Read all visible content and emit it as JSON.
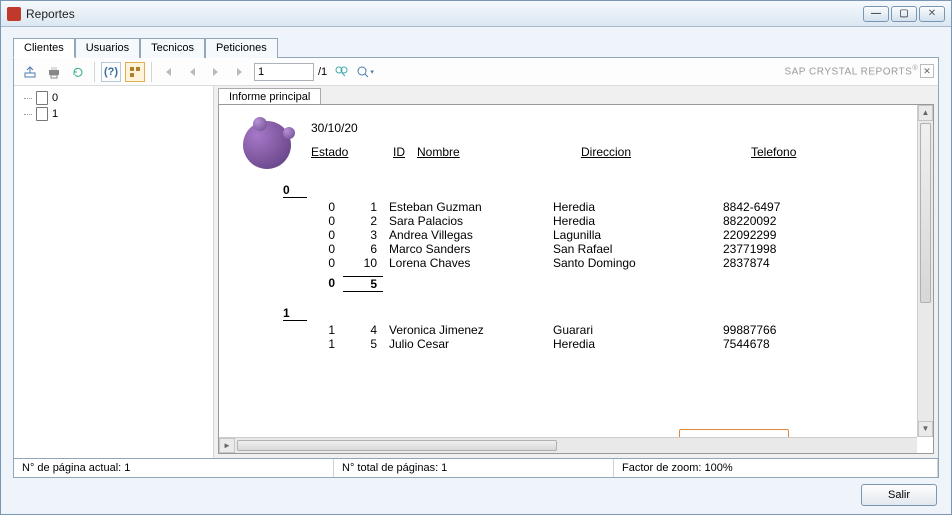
{
  "window": {
    "title": "Reportes"
  },
  "tabs": {
    "clientes": "Clientes",
    "usuarios": "Usuarios",
    "tecnicos": "Tecnicos",
    "peticiones": "Peticiones"
  },
  "toolbar": {
    "page_value": "1",
    "page_sep": "/1",
    "brand": "SAP CRYSTAL REPORTS"
  },
  "sidebar": {
    "items": [
      "0",
      "1"
    ]
  },
  "subtab": {
    "label": "Informe principal"
  },
  "report": {
    "date": "30/10/20",
    "headers": {
      "estado": "Estado",
      "id": "ID",
      "nombre": "Nombre",
      "direccion": "Direccion",
      "telefono": "Telefono"
    },
    "groups": [
      {
        "key": "0",
        "rows": [
          {
            "estado": "0",
            "id": "1",
            "nombre": "Esteban Guzman",
            "direccion": "Heredia",
            "telefono": "8842-6497"
          },
          {
            "estado": "0",
            "id": "2",
            "nombre": "Sara Palacios",
            "direccion": "Heredia",
            "telefono": "88220092"
          },
          {
            "estado": "0",
            "id": "3",
            "nombre": "Andrea Villegas",
            "direccion": "Lagunilla",
            "telefono": "22092299"
          },
          {
            "estado": "0",
            "id": "6",
            "nombre": "Marco Sanders",
            "direccion": "San Rafael",
            "telefono": "23771998"
          },
          {
            "estado": "0",
            "id": "10",
            "nombre": "Lorena Chaves",
            "direccion": "Santo Domingo",
            "telefono": "2837874"
          }
        ],
        "subtotal": {
          "estado": "0",
          "count": "5"
        }
      },
      {
        "key": "1",
        "rows": [
          {
            "estado": "1",
            "id": "4",
            "nombre": "Veronica Jimenez",
            "direccion": "Guarari",
            "telefono": "99887766"
          },
          {
            "estado": "1",
            "id": "5",
            "nombre": "Julio Cesar",
            "direccion": "Heredia",
            "telefono": "7544678"
          }
        ]
      }
    ]
  },
  "status": {
    "current_page_label": "N° de página actual: 1",
    "total_pages_label": "N° total de páginas: 1",
    "zoom_label": "Factor de zoom: 100%"
  },
  "footer": {
    "salir": "Salir"
  },
  "chart_data": {
    "type": "table",
    "title": "Clientes report 30/10/20",
    "columns": [
      "Estado",
      "ID",
      "Nombre",
      "Direccion",
      "Telefono"
    ],
    "rows": [
      [
        "0",
        1,
        "Esteban Guzman",
        "Heredia",
        "8842-6497"
      ],
      [
        "0",
        2,
        "Sara Palacios",
        "Heredia",
        "88220092"
      ],
      [
        "0",
        3,
        "Andrea Villegas",
        "Lagunilla",
        "22092299"
      ],
      [
        "0",
        6,
        "Marco Sanders",
        "San Rafael",
        "23771998"
      ],
      [
        "0",
        10,
        "Lorena Chaves",
        "Santo Domingo",
        "2837874"
      ],
      [
        "1",
        4,
        "Veronica Jimenez",
        "Guarari",
        "99887766"
      ],
      [
        "1",
        5,
        "Julio Cesar",
        "Heredia",
        "7544678"
      ]
    ]
  }
}
